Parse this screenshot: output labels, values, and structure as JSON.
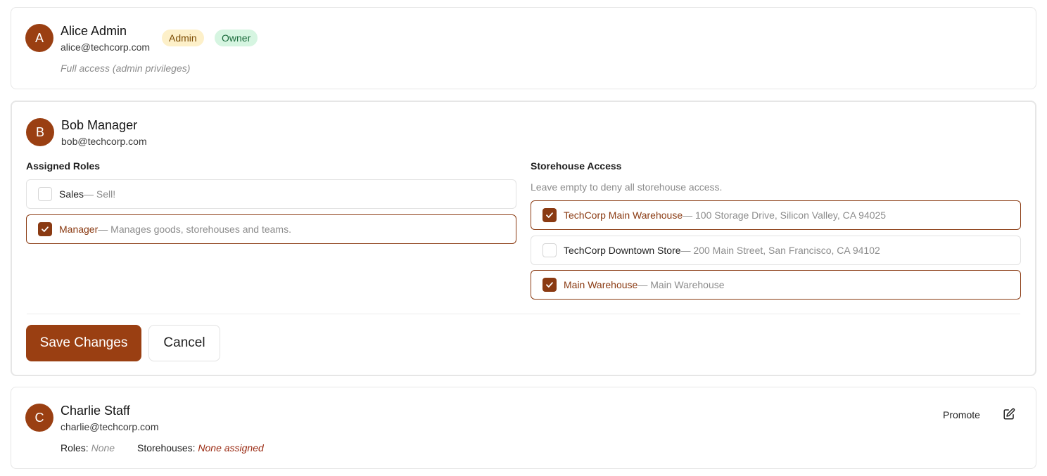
{
  "users": {
    "alice": {
      "initial": "A",
      "name": "Alice Admin",
      "email": "alice@techcorp.com",
      "badges": {
        "admin": "Admin",
        "owner": "Owner"
      },
      "note": "Full access (admin privileges)"
    },
    "bob": {
      "initial": "B",
      "name": "Bob Manager",
      "email": "bob@techcorp.com",
      "roles_label": "Assigned Roles",
      "roles": [
        {
          "title": "Sales",
          "desc": " — Sell!",
          "checked": false
        },
        {
          "title": "Manager",
          "desc": " — Manages goods, storehouses and teams.",
          "checked": true
        }
      ],
      "storehouse_label": "Storehouse Access",
      "storehouse_helper": "Leave empty to deny all storehouse access.",
      "storehouses": [
        {
          "title": "TechCorp Main Warehouse",
          "desc": " — 100 Storage Drive, Silicon Valley, CA 94025",
          "checked": true
        },
        {
          "title": "TechCorp Downtown Store",
          "desc": " — 200 Main Street, San Francisco, CA 94102",
          "checked": false
        },
        {
          "title": "Main Warehouse",
          "desc": " — Main Warehouse",
          "checked": true
        }
      ],
      "save_label": "Save Changes",
      "cancel_label": "Cancel"
    },
    "charlie": {
      "initial": "C",
      "name": "Charlie Staff",
      "email": "charlie@techcorp.com",
      "roles_label": "Roles:",
      "roles_value": "None",
      "storehouses_label": "Storehouses:",
      "storehouses_value": "None assigned",
      "promote_label": "Promote"
    }
  },
  "icons": {
    "check": "check-icon",
    "edit": "edit-icon"
  },
  "colors": {
    "accent": "#9a3f12",
    "admin_badge_bg": "#fdf0c9",
    "owner_badge_bg": "#d6f5e1"
  }
}
